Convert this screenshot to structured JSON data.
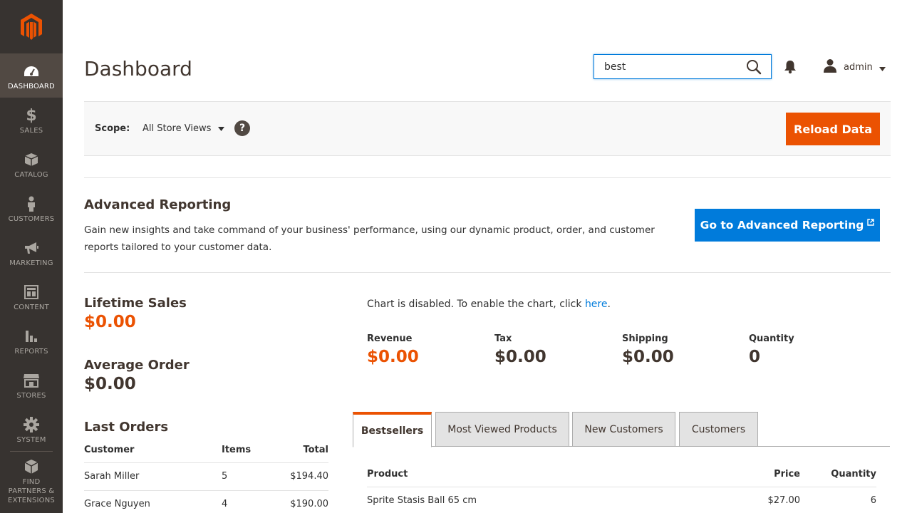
{
  "sidebar": {
    "logo": "magento-logo",
    "items": [
      {
        "label": "DASHBOARD",
        "icon": "dashboard-icon"
      },
      {
        "label": "SALES",
        "icon": "dollar-icon"
      },
      {
        "label": "CATALOG",
        "icon": "box-icon"
      },
      {
        "label": "CUSTOMERS",
        "icon": "person-icon"
      },
      {
        "label": "MARKETING",
        "icon": "megaphone-icon"
      },
      {
        "label": "CONTENT",
        "icon": "layout-icon"
      },
      {
        "label": "REPORTS",
        "icon": "bar-chart-icon"
      },
      {
        "label": "STORES",
        "icon": "storefront-icon"
      },
      {
        "label": "SYSTEM",
        "icon": "gear-icon"
      },
      {
        "label": "FIND PARTNERS & EXTENSIONS",
        "icon": "cubes-icon"
      }
    ]
  },
  "header": {
    "title": "Dashboard",
    "search_value": "best",
    "user_name": "admin"
  },
  "scope": {
    "label": "Scope:",
    "value": "All Store Views",
    "help": "?",
    "reload_label": "Reload Data"
  },
  "advanced_reporting": {
    "title": "Advanced Reporting",
    "text": "Gain new insights and take command of your business' performance, using our dynamic product, order, and customer reports tailored to your customer data.",
    "button_label": "Go to Advanced Reporting"
  },
  "stats": {
    "lifetime_sales_label": "Lifetime Sales",
    "lifetime_sales_value": "$0.00",
    "average_order_label": "Average Order",
    "average_order_value": "$0.00"
  },
  "last_orders": {
    "title": "Last Orders",
    "headers": {
      "customer": "Customer",
      "items": "Items",
      "total": "Total"
    },
    "rows": [
      {
        "customer": "Sarah Miller",
        "items": "5",
        "total": "$194.40"
      },
      {
        "customer": "Grace Nguyen",
        "items": "4",
        "total": "$190.00"
      }
    ]
  },
  "chart": {
    "note_prefix": "Chart is disabled. To enable the chart, click ",
    "note_link": "here",
    "note_suffix": "."
  },
  "totals": [
    {
      "label": "Revenue",
      "value": "$0.00"
    },
    {
      "label": "Tax",
      "value": "$0.00"
    },
    {
      "label": "Shipping",
      "value": "$0.00"
    },
    {
      "label": "Quantity",
      "value": "0"
    }
  ],
  "tabs": [
    {
      "label": "Bestsellers",
      "active": true
    },
    {
      "label": "Most Viewed Products",
      "active": false
    },
    {
      "label": "New Customers",
      "active": false
    },
    {
      "label": "Customers",
      "active": false
    }
  ],
  "bestsellers": {
    "headers": {
      "product": "Product",
      "price": "Price",
      "quantity": "Quantity"
    },
    "rows": [
      {
        "product": "Sprite Stasis Ball 65 cm",
        "price": "$27.00",
        "quantity": "6"
      }
    ]
  },
  "colors": {
    "sidebar": "#373330",
    "accent_orange": "#eb5202",
    "link_blue": "#007bdb"
  }
}
